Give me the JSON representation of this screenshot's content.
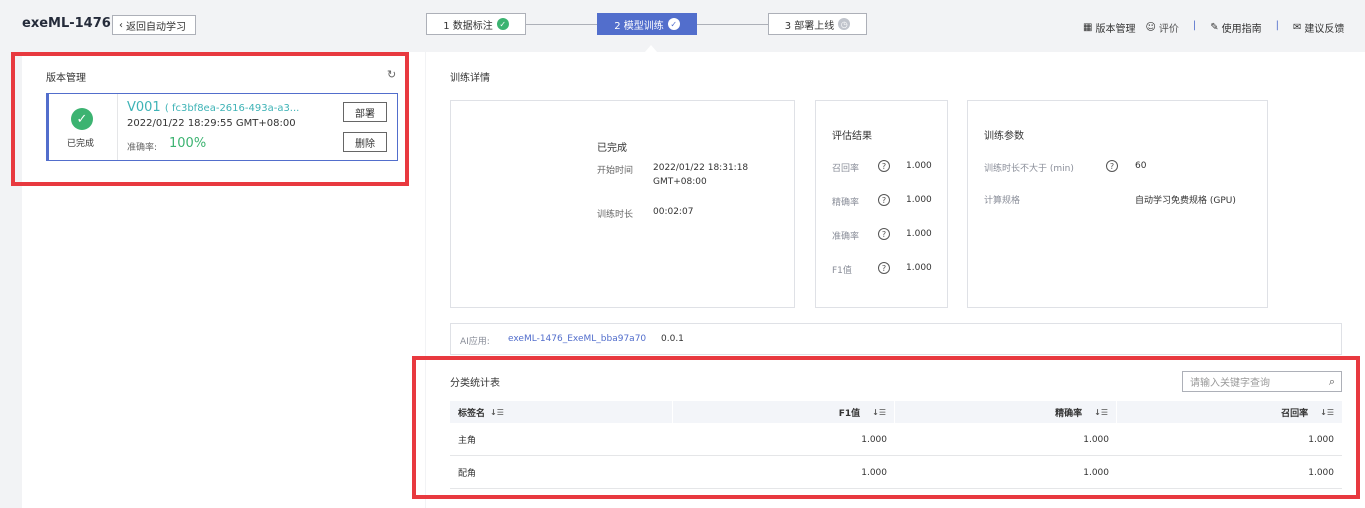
{
  "header": {
    "app_title": "exeML-1476",
    "back_label": "返回自动学习",
    "steps": [
      {
        "label": "1 数据标注"
      },
      {
        "label": "2 模型训练"
      },
      {
        "label": "3 部署上线"
      }
    ],
    "actions": {
      "version_mgmt": "版本管理",
      "rate": "评价",
      "guide": "使用指南",
      "feedback": "建议反馈"
    }
  },
  "version_panel": {
    "title": "版本管理",
    "card": {
      "status": "已完成",
      "version": "V001",
      "version_id": "( fc3bf8ea-2616-493a-a3...",
      "date": "2022/01/22 18:29:55 GMT+08:00",
      "accuracy_label": "准确率:",
      "accuracy": "100%",
      "deploy_label": "部署",
      "delete_label": "删除"
    }
  },
  "training": {
    "title": "训练详情",
    "summary": {
      "status": "已完成",
      "start_label": "开始时间",
      "start_value": "2022/01/22 18:31:18 GMT+08:00",
      "start_line1": "2022/01/22 18:31:18",
      "start_line2": "GMT+08:00",
      "duration_label": "训练时长",
      "duration_value": "00:02:07"
    },
    "eval": {
      "title": "评估结果",
      "rows": [
        {
          "label": "召回率",
          "value": "1.000"
        },
        {
          "label": "精确率",
          "value": "1.000"
        },
        {
          "label": "准确率",
          "value": "1.000"
        },
        {
          "label": "F1值",
          "value": "1.000"
        }
      ]
    },
    "params": {
      "title": "训练参数",
      "max_duration_label": "训练时长不大于 (min)",
      "max_duration_value": "60",
      "compute_label": "计算规格",
      "compute_value": "自动学习免费规格 (GPU)"
    }
  },
  "ai_app": {
    "label": "AI应用:",
    "name": "exeML-1476_ExeML_bba97a70",
    "version": "0.0.1"
  },
  "stats": {
    "title": "分类统计表",
    "search_placeholder": "请输入关键字查询",
    "columns": [
      "标签名",
      "F1值",
      "精确率",
      "召回率"
    ],
    "rows": [
      {
        "label": "主角",
        "f1": "1.000",
        "precision": "1.000",
        "recall": "1.000"
      },
      {
        "label": "配角",
        "f1": "1.000",
        "precision": "1.000",
        "recall": "1.000"
      }
    ]
  }
}
